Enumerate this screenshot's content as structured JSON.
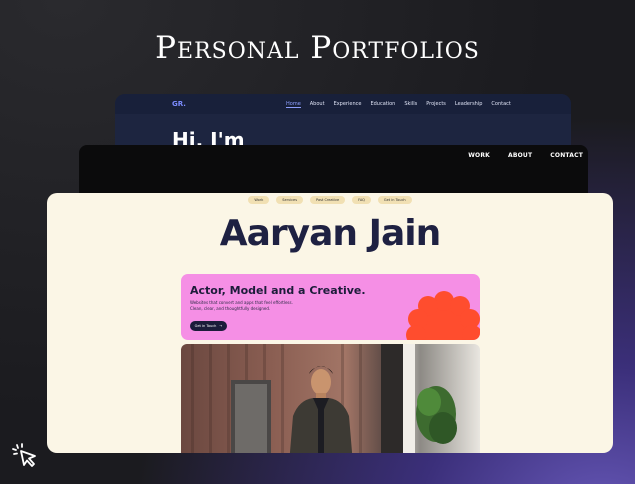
{
  "headline": "Personal Portfolios",
  "card1": {
    "logo": "GR.",
    "nav": [
      "Home",
      "About",
      "Experience",
      "Education",
      "Skills",
      "Projects",
      "Leadership",
      "Contact"
    ],
    "hero_text": "Hi, I'm"
  },
  "card2": {
    "nav": [
      "WORK",
      "ABOUT",
      "CONTACT"
    ]
  },
  "card3": {
    "pills": [
      "Work",
      "Services",
      "Past Creative",
      "FAQ",
      "Get in Touch"
    ],
    "name": "Aaryan Jain",
    "tagline": "Actor, Model and a Creative.",
    "sub1": "Websites that convert and apps that feel effortless.",
    "sub2": "Clean, clear, and thoughtfully designed.",
    "cta": "Get in Touch",
    "cta_arrow": "→"
  },
  "colors": {
    "pink_panel": "#f58fe5",
    "flower": "#ff4d2e",
    "cream": "#fbf6e6",
    "navy_text": "#1e2142"
  },
  "icons": [
    "cursor-click-icon",
    "flower-decoration",
    "arrow-right-icon"
  ]
}
